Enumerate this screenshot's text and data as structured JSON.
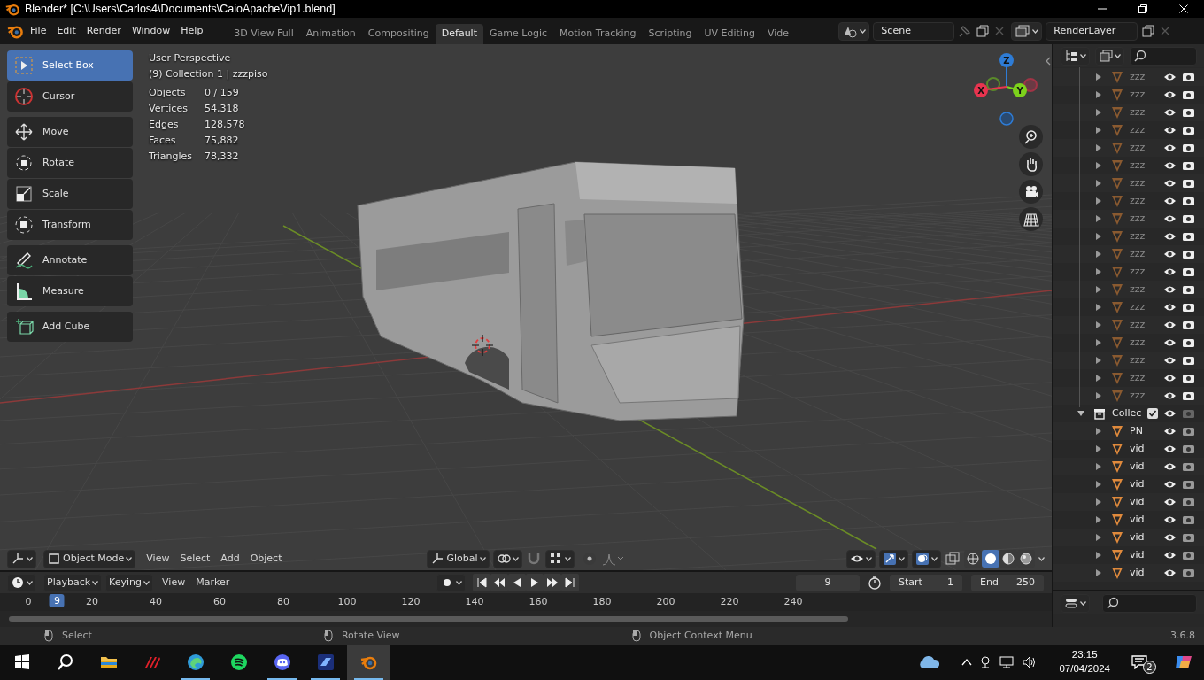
{
  "window": {
    "title": "Blender* [C:\\Users\\Carlos4\\Documents\\CaioApacheVip1.blend]"
  },
  "menu": [
    "File",
    "Edit",
    "Render",
    "Window",
    "Help"
  ],
  "workspaces": [
    {
      "label": "3D View Full",
      "selected": false
    },
    {
      "label": "Animation",
      "selected": false
    },
    {
      "label": "Compositing",
      "selected": false
    },
    {
      "label": "Default",
      "selected": true
    },
    {
      "label": "Game Logic",
      "selected": false
    },
    {
      "label": "Motion Tracking",
      "selected": false
    },
    {
      "label": "Scripting",
      "selected": false
    },
    {
      "label": "UV Editing",
      "selected": false
    },
    {
      "label": "Vide",
      "selected": false
    }
  ],
  "scene": {
    "value": "Scene"
  },
  "view_layer": {
    "value": "RenderLayer"
  },
  "toolbar": [
    [
      {
        "kind": "select",
        "label": "Select Box",
        "selected": true
      },
      {
        "kind": "cursor",
        "label": "Cursor",
        "selected": false
      }
    ],
    [
      {
        "kind": "move",
        "label": "Move",
        "selected": false
      },
      {
        "kind": "rotate",
        "label": "Rotate",
        "selected": false
      },
      {
        "kind": "scale",
        "label": "Scale",
        "selected": false
      },
      {
        "kind": "transform",
        "label": "Transform",
        "selected": false
      }
    ],
    [
      {
        "kind": "annotate",
        "label": "Annotate",
        "selected": false
      },
      {
        "kind": "measure",
        "label": "Measure",
        "selected": false
      }
    ],
    [
      {
        "kind": "add_cube",
        "label": "Add Cube",
        "selected": false
      }
    ]
  ],
  "viewport": {
    "view_name": "User Perspective",
    "context": "(9) Collection 1 | zzzpiso",
    "stats": [
      {
        "label": "Objects",
        "value": "0 / 159"
      },
      {
        "label": "Vertices",
        "value": "54,318"
      },
      {
        "label": "Edges",
        "value": "128,578"
      },
      {
        "label": "Faces",
        "value": "75,882"
      },
      {
        "label": "Triangles",
        "value": "78,332"
      }
    ],
    "gizmo": [
      {
        "label": "Z",
        "color": "#2e7cd6"
      },
      {
        "label": "X",
        "color": "#e8344f"
      },
      {
        "label": "Y",
        "color": "#7dd11c"
      }
    ]
  },
  "viewport_header": {
    "mode": "Object Mode",
    "menus": [
      "View",
      "Select",
      "Add",
      "Object"
    ],
    "orientation": "Global",
    "shading": [
      {
        "kind": "wireframe",
        "selected": false
      },
      {
        "kind": "solid",
        "selected": true
      },
      {
        "kind": "material",
        "selected": false
      },
      {
        "kind": "rendered",
        "selected": false
      }
    ]
  },
  "timeline": {
    "menus": [
      "Playback",
      "Keying"
    ],
    "view_menus": [
      "View",
      "Marker"
    ],
    "current_frame": "9",
    "start": {
      "label": "Start",
      "value": "1"
    },
    "end": {
      "label": "End",
      "value": "250"
    },
    "ticks": [
      "0",
      "20",
      "40",
      "60",
      "80",
      "100",
      "120",
      "140",
      "160",
      "180",
      "200",
      "220",
      "240"
    ],
    "playhead": "9"
  },
  "outliner": {
    "items": [
      {
        "kind": "mesh",
        "name": "zzz",
        "expanded": false,
        "muted": true
      },
      {
        "kind": "mesh",
        "name": "zzz",
        "expanded": false,
        "muted": true
      },
      {
        "kind": "mesh",
        "name": "zzz",
        "expanded": false,
        "muted": true
      },
      {
        "kind": "mesh",
        "name": "zzz",
        "expanded": false,
        "muted": true
      },
      {
        "kind": "mesh",
        "name": "zzz",
        "expanded": false,
        "muted": true
      },
      {
        "kind": "mesh",
        "name": "zzz",
        "expanded": false,
        "muted": true
      },
      {
        "kind": "mesh",
        "name": "zzz",
        "expanded": false,
        "muted": true
      },
      {
        "kind": "mesh",
        "name": "zzz",
        "expanded": false,
        "muted": true
      },
      {
        "kind": "mesh",
        "name": "zzz",
        "expanded": false,
        "muted": true
      },
      {
        "kind": "mesh",
        "name": "zzz",
        "expanded": false,
        "muted": true
      },
      {
        "kind": "mesh",
        "name": "zzz",
        "expanded": false,
        "muted": true
      },
      {
        "kind": "mesh",
        "name": "zzz",
        "expanded": false,
        "muted": true
      },
      {
        "kind": "mesh",
        "name": "zzz",
        "expanded": false,
        "muted": true
      },
      {
        "kind": "mesh",
        "name": "zzz",
        "expanded": false,
        "muted": true
      },
      {
        "kind": "mesh",
        "name": "zzz",
        "expanded": false,
        "muted": true
      },
      {
        "kind": "mesh",
        "name": "zzz",
        "expanded": false,
        "muted": true
      },
      {
        "kind": "mesh",
        "name": "zzz",
        "expanded": false,
        "muted": true
      },
      {
        "kind": "mesh",
        "name": "zzz",
        "expanded": false,
        "muted": true
      },
      {
        "kind": "mesh",
        "name": "zzz",
        "expanded": false,
        "muted": true
      },
      {
        "kind": "collection",
        "name": "Collec",
        "expanded": true,
        "checked": true,
        "children": [
          {
            "kind": "mesh",
            "name": "PN",
            "expanded": false,
            "muted": false
          },
          {
            "kind": "mesh",
            "name": "vid",
            "expanded": false,
            "muted": false
          },
          {
            "kind": "mesh",
            "name": "vid",
            "expanded": false,
            "muted": false
          },
          {
            "kind": "mesh",
            "name": "vid",
            "expanded": false,
            "muted": false
          },
          {
            "kind": "mesh",
            "name": "vid",
            "expanded": false,
            "muted": false
          },
          {
            "kind": "mesh",
            "name": "vid",
            "expanded": false,
            "muted": false
          },
          {
            "kind": "mesh",
            "name": "vid",
            "expanded": false,
            "muted": false
          },
          {
            "kind": "mesh",
            "name": "vid",
            "expanded": false,
            "muted": false
          },
          {
            "kind": "mesh",
            "name": "vid",
            "expanded": false,
            "muted": false
          }
        ]
      }
    ]
  },
  "status_bar": {
    "hints": [
      "Select",
      "Rotate View",
      "Object Context Menu"
    ],
    "version": "3.6.8"
  },
  "taskbar": {
    "apps": [
      {
        "kind": "start",
        "running": false,
        "selected": false
      },
      {
        "kind": "search",
        "running": false,
        "selected": false
      },
      {
        "kind": "folder",
        "running": false,
        "selected": false
      },
      {
        "kind": "stripes",
        "running": false,
        "selected": false
      },
      {
        "kind": "swirl",
        "running": true,
        "selected": false
      },
      {
        "kind": "bars",
        "running": false,
        "selected": false
      },
      {
        "kind": "controller",
        "running": true,
        "selected": false
      },
      {
        "kind": "square",
        "running": true,
        "selected": false
      },
      {
        "kind": "blender",
        "running": true,
        "selected": true
      }
    ],
    "time": "23:15",
    "date": "07/04/2024",
    "notifications": "2"
  }
}
